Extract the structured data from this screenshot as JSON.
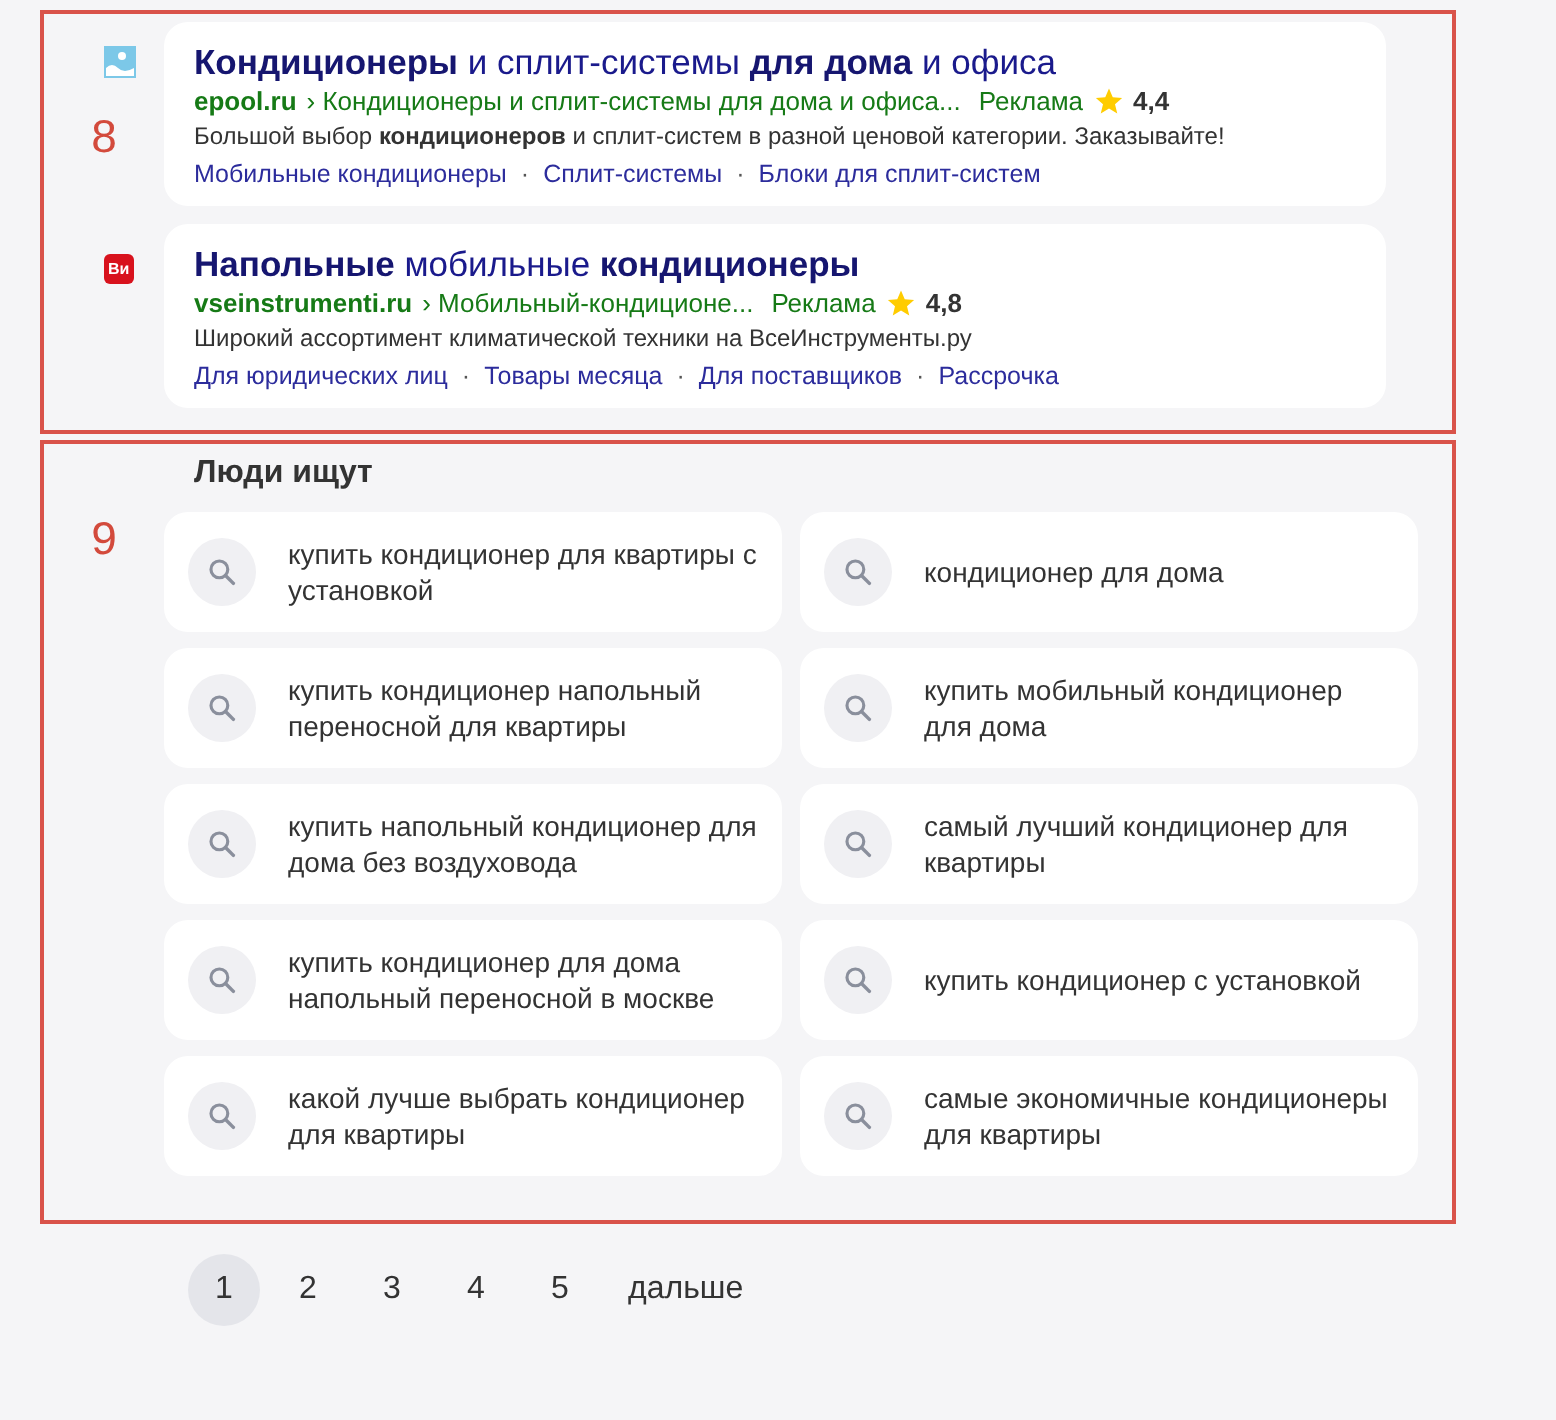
{
  "ads_section": {
    "annotation": "8",
    "ads": [
      {
        "favicon": {
          "kind": "wave"
        },
        "title": "**Кондиционеры** и сплит-системы **для дома** и офиса",
        "domain": "epool.ru",
        "path": "› Кондиционеры и сплит-системы для дома и офиса...",
        "ad_label": "Реклама",
        "rating": "4,4",
        "description": "Большой выбор **кондиционеров** и сплит-систем в разной ценовой категории. Заказывайте!",
        "sitelinks": [
          "Мобильные кондиционеры",
          "Сплит-системы",
          "Блоки для сплит-систем"
        ],
        "separator": "·"
      },
      {
        "favicon": {
          "kind": "badge",
          "text": "Ви"
        },
        "title": "**Напольные** мобильные **кондиционеры**",
        "domain": "vseinstrumenti.ru",
        "path": "› Мобильный-кондиционе...",
        "ad_label": "Реклама",
        "rating": "4,8",
        "description": "Широкий ассортимент климатической техники на ВсеИнструменты.ру",
        "sitelinks": [
          "Для юридических лиц",
          "Товары месяца",
          "Для поставщиков",
          "Рассрочка"
        ],
        "separator": "·"
      }
    ]
  },
  "people_search": {
    "annotation": "9",
    "title": "Люди ищут",
    "queries": [
      "купить кондиционер для квартиры с установкой",
      "кондиционер для дома",
      "купить кондиционер напольный переносной для квартиры",
      "купить мобильный кондиционер для дома",
      "купить напольный кондиционер для дома без воздуховода",
      "самый лучший кондиционер для квартиры",
      "купить кондиционер для дома напольный переносной в москве",
      "купить кондиционер с установкой",
      "какой лучше выбрать кондиционер для квартиры",
      "самые экономичные кондиционеры для квартиры"
    ]
  },
  "pagination": {
    "pages": [
      {
        "label": "1",
        "selected": true
      },
      {
        "label": "2",
        "selected": false
      },
      {
        "label": "3",
        "selected": false
      },
      {
        "label": "4",
        "selected": false
      },
      {
        "label": "5",
        "selected": false
      }
    ],
    "next": "дальше"
  }
}
